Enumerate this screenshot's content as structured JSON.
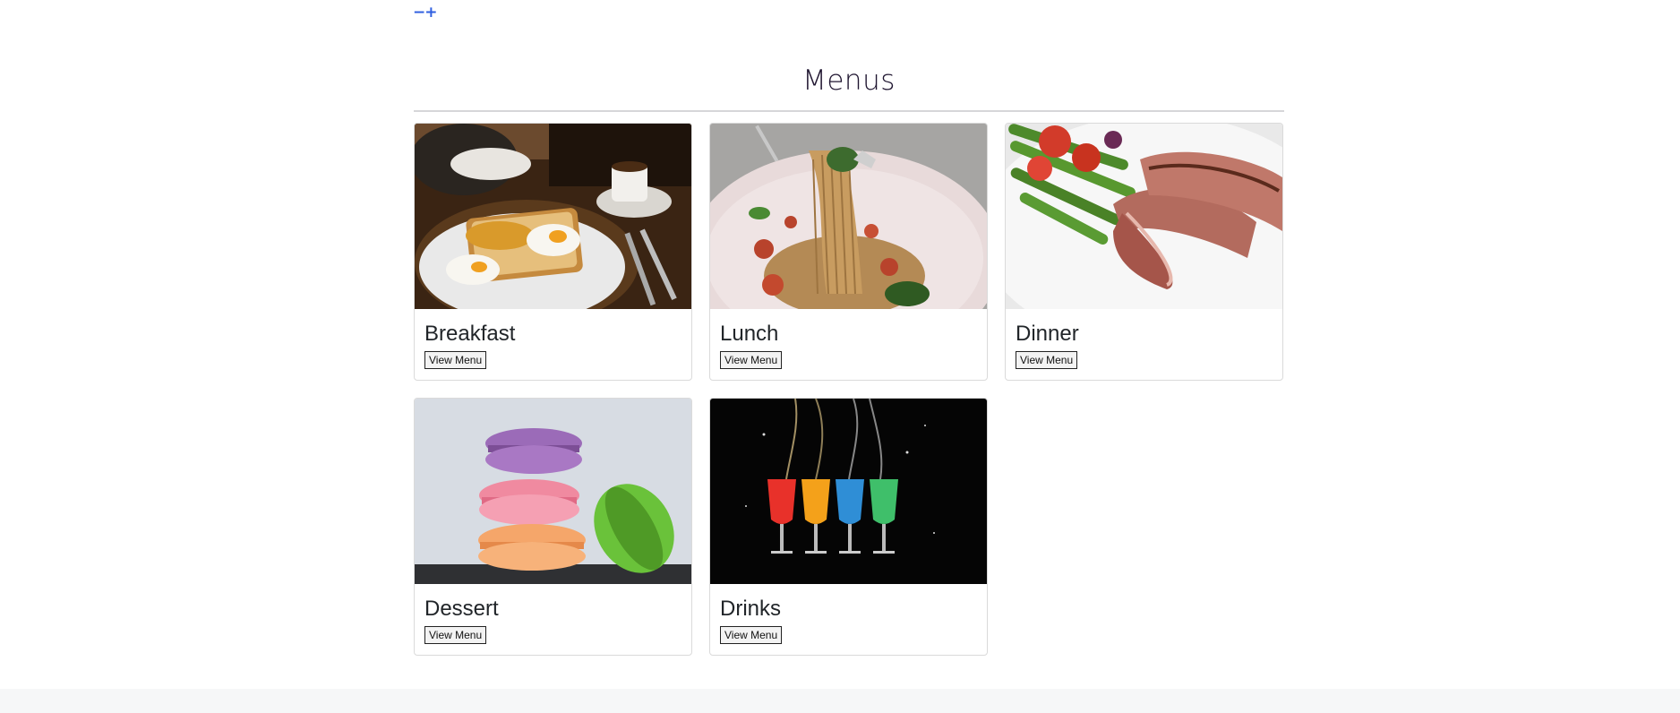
{
  "header": {
    "logo_text": "−+"
  },
  "page": {
    "title": "Menus"
  },
  "menus": [
    {
      "name": "Breakfast",
      "button": "View Menu"
    },
    {
      "name": "Lunch",
      "button": "View Menu"
    },
    {
      "name": "Dinner",
      "button": "View Menu"
    },
    {
      "name": "Dessert",
      "button": "View Menu"
    },
    {
      "name": "Drinks",
      "button": "View Menu"
    }
  ]
}
